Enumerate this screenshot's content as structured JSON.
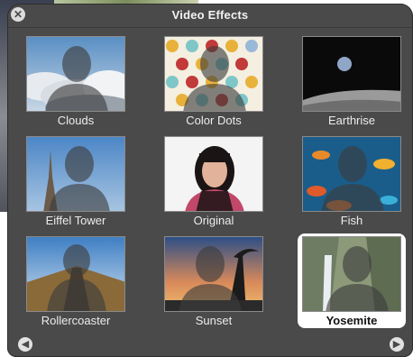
{
  "window": {
    "title": "Video Effects"
  },
  "effects": [
    {
      "label": "Clouds",
      "selected": false
    },
    {
      "label": "Color Dots",
      "selected": false
    },
    {
      "label": "Earthrise",
      "selected": false
    },
    {
      "label": "Eiffel Tower",
      "selected": false
    },
    {
      "label": "Original",
      "selected": false
    },
    {
      "label": "Fish",
      "selected": false
    },
    {
      "label": "Rollercoaster",
      "selected": false
    },
    {
      "label": "Sunset",
      "selected": false
    },
    {
      "label": "Yosemite",
      "selected": true
    }
  ],
  "icons": {
    "close": "close-icon",
    "prev": "left-arrow-icon",
    "next": "right-arrow-icon"
  },
  "colors": {
    "panel": "#4a4a4a",
    "title": "#f2f2f2",
    "selected_bg": "#ffffff"
  }
}
